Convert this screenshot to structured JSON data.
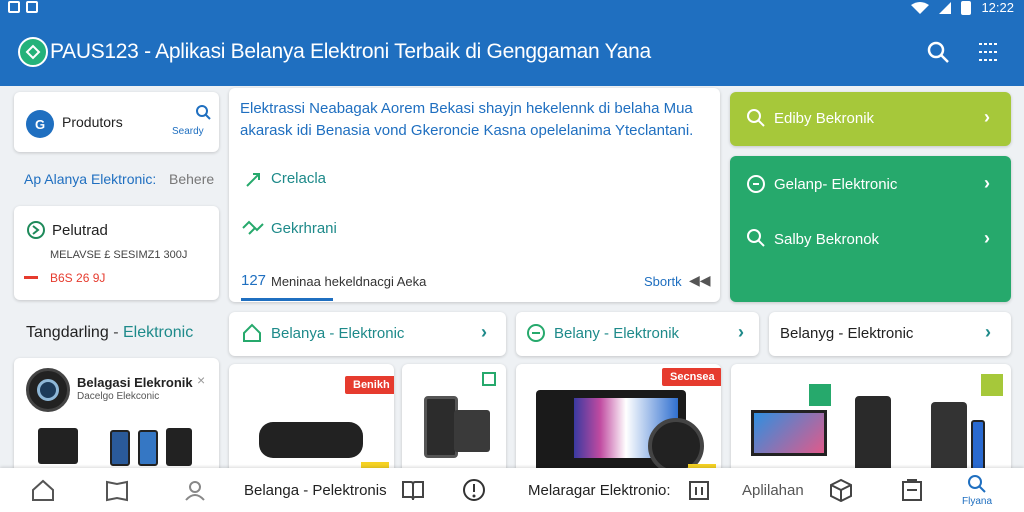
{
  "status_bar": {
    "time": "12:22"
  },
  "header": {
    "title": "PAUS123 - Aplikasi Belanya Elektroni Terbaik di Genggaman Yana"
  },
  "left": {
    "products_label": "Produtors",
    "search_label": "Seardy",
    "section_link": "Ap Alanya Elektronic:",
    "section_more": "Behere",
    "product_title": "Pelutrad",
    "product_sub": "MELAVSE £ SESIMZ1 300J",
    "product_price": "B6S 26 9J",
    "category_heading": "Tangdarling",
    "category_sub": "Elektronic",
    "promo_title": "Belagasi Elekronik",
    "promo_sub": "Dacelgo Elekconic"
  },
  "center": {
    "description": "Elektrassi Neabagak Aorem Bekasi shayjn hekelennk di belaha Mua akarask idi Benasia vond Gkeroncie Kasna opelelanima Yteclantani.",
    "item1": "Crelacla",
    "item2": "Gekrhrani",
    "footer_count": "127",
    "footer_text": "Meninaa hekeldnacgi Aeka",
    "footer_action": "Sbortk"
  },
  "right": {
    "lime_item": "Ediby Bekronik",
    "green_item1": "Gelanp- Elektronic",
    "green_item2": "Salby Bekronok"
  },
  "pills": [
    {
      "label": "Belanya - Elektronic"
    },
    {
      "label": "Belany - Elektronik"
    },
    {
      "label": "Belanyg - Elektronic"
    }
  ],
  "tiles": {
    "tag1": "Benikh",
    "tag2": "Secnsea"
  },
  "bottom_nav": {
    "label1": "Belanga - Pelektronis",
    "label2": "Melaragar Elektronio:",
    "label3": "Aplilahan",
    "label4": "Flyana"
  },
  "colors": {
    "primary": "#1f6fc0",
    "accent_green": "#26a96c",
    "accent_lime": "#a6c83a",
    "accent_teal": "#1e8a8a",
    "sale_red": "#e63b2e"
  }
}
